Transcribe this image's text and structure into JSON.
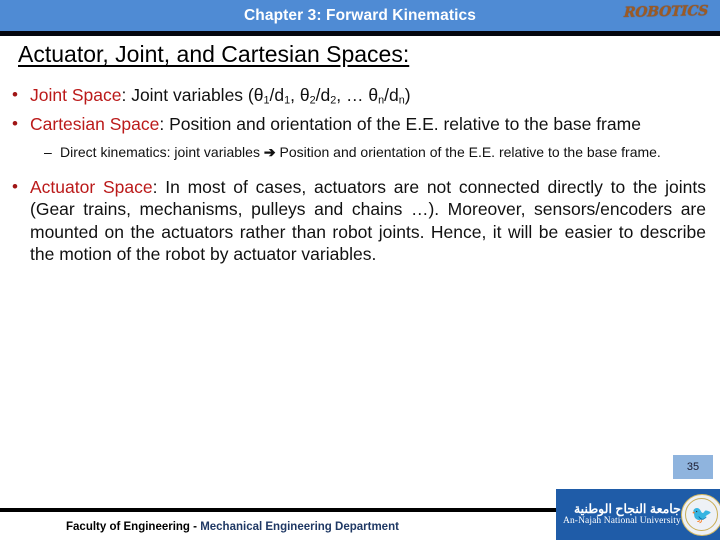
{
  "header": {
    "chapter_title": "Chapter 3: Forward Kinematics",
    "brand_logo_text": "ROBOTICS",
    "background_color": "#4F8BD4",
    "rule_color": "#05070F",
    "brand_color": "#9C5A24"
  },
  "slide": {
    "title": "Actuator, Joint, and Cartesian Spaces:",
    "accent_color": "#BB1A1A"
  },
  "bullets": {
    "joint_space": {
      "marker": "•",
      "term": "Joint Space",
      "separator": ": ",
      "text_before": "Joint variables (θ",
      "sub1": "1",
      "mid1": "/d",
      "sub2": "1",
      "mid2": ", θ",
      "sub3": "2",
      "mid3": "/d",
      "sub4": "2",
      "mid4": ", … θ",
      "sub5": "n",
      "mid5": "/d",
      "sub6": "n",
      "tail": ")"
    },
    "cartesian_space": {
      "marker": "•",
      "term": "Cartesian Space",
      "separator": ": ",
      "text": "Position and orientation of the E.E. relative to the base frame"
    },
    "direct_kinematics": {
      "marker": "–",
      "text_before": "Direct kinematics: joint variables ",
      "arrow": "➔",
      "text_after": " Position and orientation of the E.E. relative to the base frame."
    },
    "actuator_space": {
      "marker": "•",
      "term": "Actuator Space",
      "separator": ": ",
      "text": "In most of cases, actuators are not connected directly to the joints (Gear trains, mechanisms, pulleys and chains …). Moreover, sensors/encoders are mounted on the actuators rather than robot joints. Hence, it will be easier to describe the motion of the robot by actuator variables."
    }
  },
  "page_number": {
    "value": "35",
    "background_color": "#8FB4DE"
  },
  "footer": {
    "text_primary": "Faculty of Engineering - ",
    "text_secondary": "Mechanical Engineering Department",
    "primary_color": "#000000",
    "secondary_color": "#1F3864",
    "university_arabic": "جامعة النجاح الوطنية",
    "university_english": "An-Najah National University",
    "logo_background_color": "#1F5CA8"
  }
}
